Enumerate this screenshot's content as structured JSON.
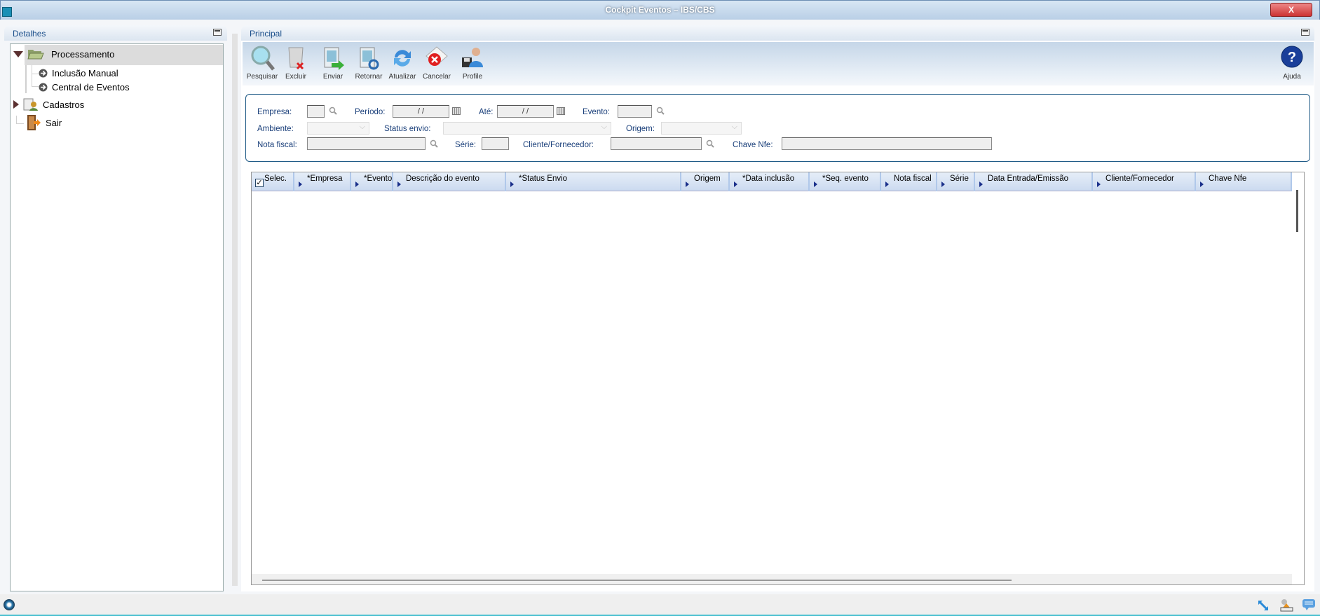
{
  "window": {
    "title": "Cockpit Eventos – IBS/CBS",
    "close_label": "X"
  },
  "left_panel": {
    "title": "Detalhes",
    "tree": [
      {
        "label": "Processamento",
        "expanded": true,
        "selected": true,
        "icon": "folder-open-icon"
      },
      {
        "label": "Inclusão Manual",
        "icon": "arrow-circle-icon"
      },
      {
        "label": "Central de Eventos",
        "icon": "arrow-circle-icon"
      },
      {
        "label": "Cadastros",
        "expanded": false,
        "icon": "cadastros-icon"
      },
      {
        "label": "Sair",
        "icon": "exit-door-icon"
      }
    ]
  },
  "main_panel": {
    "title": "Principal"
  },
  "toolbar": {
    "buttons": [
      {
        "label": "Pesquisar",
        "icon": "search-icon"
      },
      {
        "label": "Excluir",
        "icon": "trash-icon"
      },
      {
        "label": "Enviar",
        "icon": "send-icon"
      },
      {
        "label": "Retornar",
        "icon": "return-icon"
      },
      {
        "label": "Atualizar",
        "icon": "refresh-icon"
      },
      {
        "label": "Cancelar",
        "icon": "cancel-icon"
      },
      {
        "label": "Profile",
        "icon": "profile-icon"
      }
    ],
    "help": {
      "label": "Ajuda",
      "icon": "help-icon"
    }
  },
  "filters": {
    "empresa": {
      "label": "Empresa:",
      "value": ""
    },
    "periodo": {
      "label": "Período:",
      "value": " / /"
    },
    "ate": {
      "label": "Até:",
      "value": " / /"
    },
    "evento": {
      "label": "Evento:",
      "value": ""
    },
    "ambiente": {
      "label": "Ambiente:",
      "value": ""
    },
    "status_envio": {
      "label": "Status envio:",
      "value": ""
    },
    "origem": {
      "label": "Origem:",
      "value": ""
    },
    "nota_fiscal": {
      "label": "Nota fiscal:",
      "value": ""
    },
    "serie": {
      "label": "Série:",
      "value": ""
    },
    "cliente_fornecedor": {
      "label": "Cliente/Fornecedor:",
      "value": ""
    },
    "chave_nfe": {
      "label": "Chave Nfe:",
      "value": ""
    }
  },
  "grid": {
    "select_all_checked": true,
    "columns": [
      "Selec.",
      "*Empresa",
      "*Evento",
      "Descrição do evento",
      "*Status Envio",
      "Origem",
      "*Data inclusão",
      "*Seq. evento",
      "Nota fiscal",
      "Série",
      "Data Entrada/Emissão",
      "Cliente/Fornecedor",
      "Chave Nfe"
    ],
    "rows": []
  },
  "statusbar": {
    "icons": [
      "resize-icon",
      "tools-icon",
      "message-icon"
    ]
  }
}
